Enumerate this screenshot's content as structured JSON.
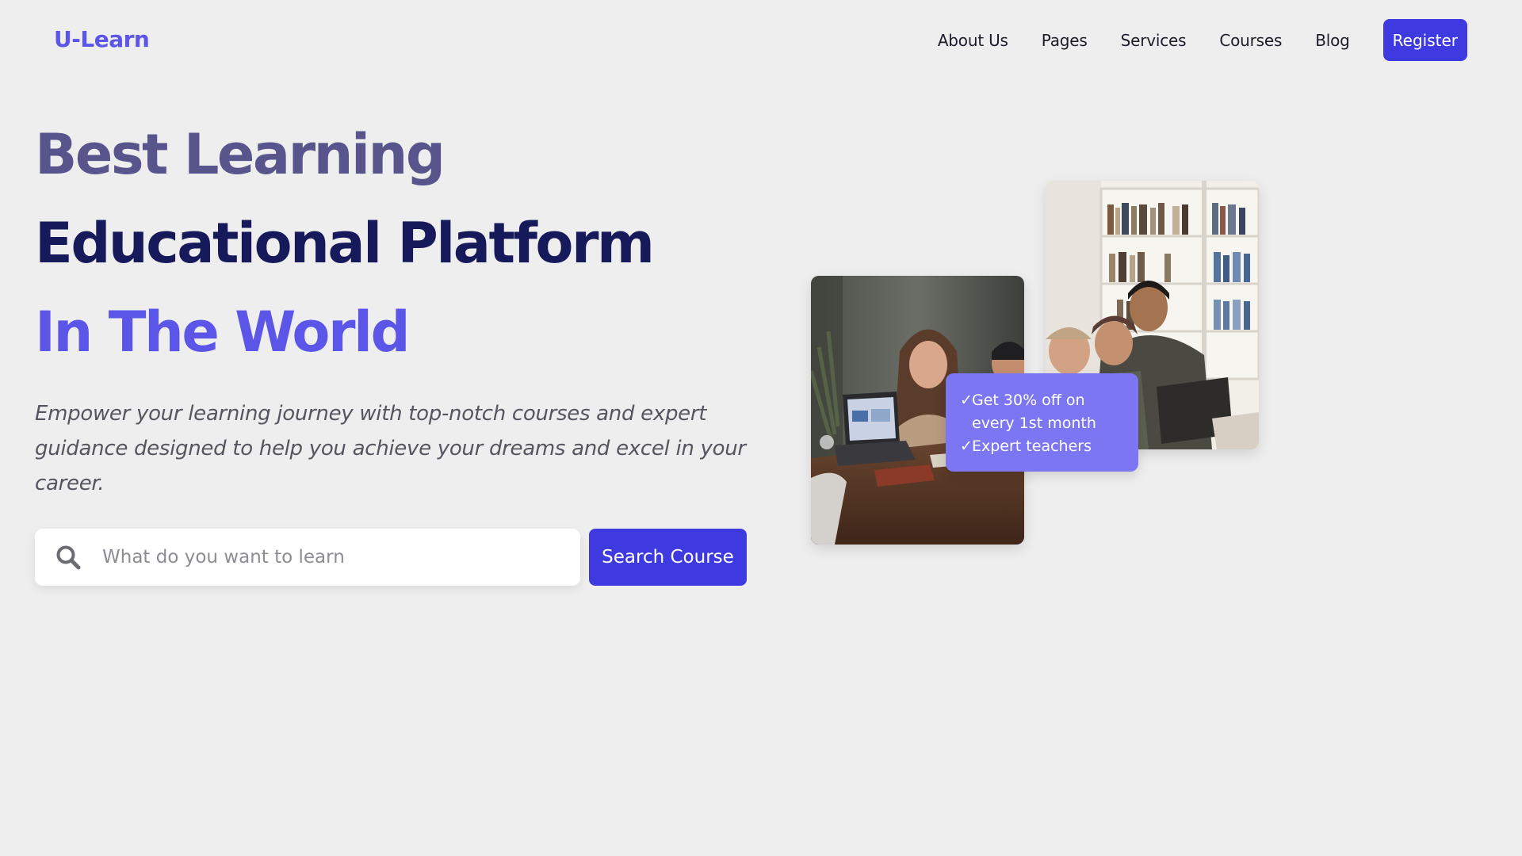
{
  "brand": {
    "logo_text": "U-Learn",
    "accent": "#5b55e8",
    "primary": "#3f39e0"
  },
  "nav": {
    "links": [
      {
        "label": "About Us"
      },
      {
        "label": "Pages"
      },
      {
        "label": "Services"
      },
      {
        "label": "Courses"
      },
      {
        "label": "Blog"
      }
    ],
    "register_label": "Register"
  },
  "hero": {
    "line1": "Best Learning",
    "line2": "Educational Platform",
    "line3": "In The World",
    "description": "Empower your learning journey with top-notch courses and expert guidance designed to help you achieve your dreams and excel in your career."
  },
  "search": {
    "placeholder": "What do you want to learn",
    "value": "",
    "button_label": "Search Course",
    "icon": "search-icon"
  },
  "promo": {
    "check_glyph": "✓",
    "items": [
      {
        "text": "Get 30% off on every 1st month"
      },
      {
        "text": "Expert teachers"
      }
    ]
  }
}
